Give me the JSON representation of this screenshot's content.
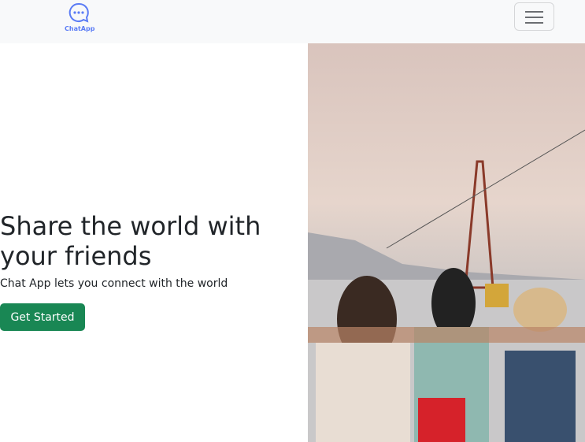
{
  "nav": {
    "logo_text": "ChatApp",
    "menu_icon": "hamburger-icon"
  },
  "hero": {
    "title": "Share the world with your friends",
    "subtitle": "Chat App lets you connect with the world",
    "cta": "Get Started",
    "image_alt": "friends by the sea with cable car"
  },
  "colors": {
    "primary": "#198754",
    "logo": "#5b7cf5"
  }
}
